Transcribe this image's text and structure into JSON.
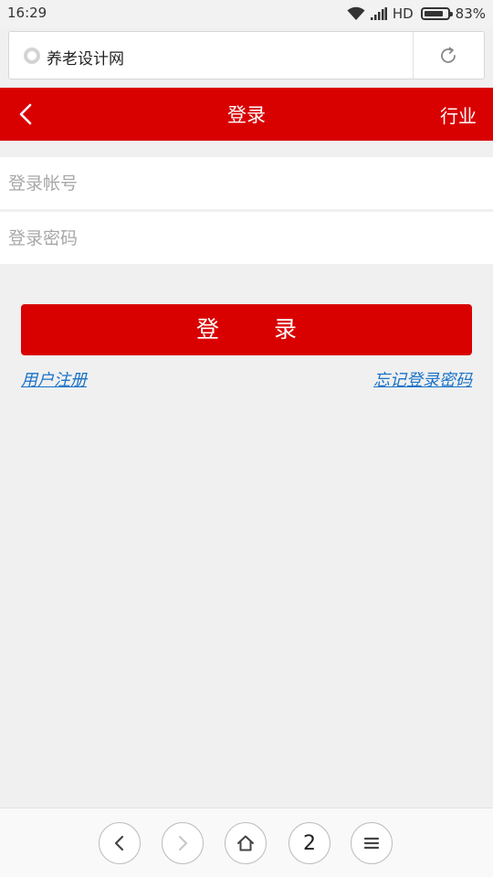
{
  "status_bar": {
    "time": "16:29",
    "network": "HD",
    "battery": "83%",
    "battery_level": 0.83
  },
  "browser": {
    "site_title": "养老设计网",
    "icons": {
      "site": "site-favicon-icon",
      "reload": "reload-icon"
    }
  },
  "header": {
    "title": "登录",
    "right_label": "行业",
    "back_icon": "chevron-left-icon",
    "accent": "#d90000"
  },
  "form": {
    "account_placeholder": "登录帐号",
    "password_placeholder": "登录密码",
    "login_label": "登 录"
  },
  "links": {
    "register": "用户注册",
    "forgot": "忘记登录密码",
    "color": "#1a73c9"
  },
  "bottom_nav": {
    "tab_count": "2",
    "icons": [
      "back-arrow-icon",
      "forward-arrow-icon",
      "home-icon",
      "tab-count",
      "menu-icon"
    ]
  }
}
